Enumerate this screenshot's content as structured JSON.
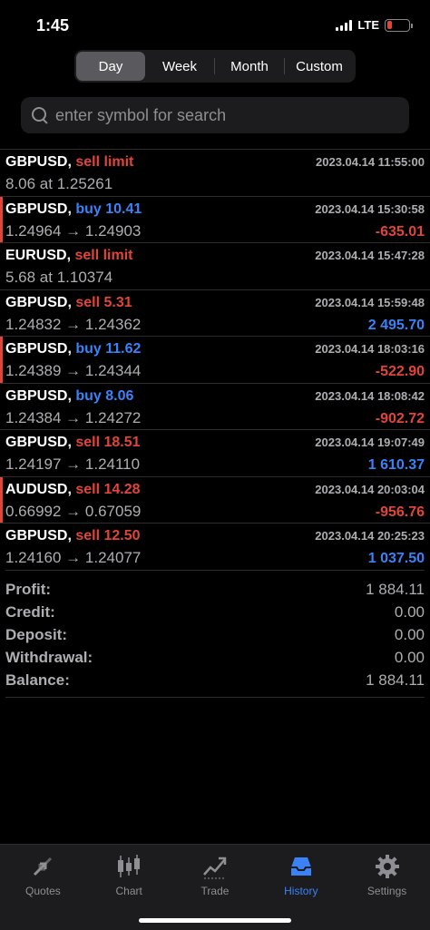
{
  "status": {
    "time": "1:45",
    "network": "LTE"
  },
  "periods": [
    "Day",
    "Week",
    "Month",
    "Custom"
  ],
  "search": {
    "placeholder": "enter symbol for search"
  },
  "deals": [
    {
      "symbol": "GBPUSD,",
      "type": "sell limit",
      "side": "sell",
      "date": "2023.04.14 11:55:00",
      "line2": "8.06 at 1.25261",
      "profit": "",
      "marked": false
    },
    {
      "symbol": "GBPUSD,",
      "type": "buy 10.41",
      "side": "buy",
      "date": "2023.04.14 15:30:58",
      "line2": "1.24964 → 1.24903",
      "profit": "-635.01",
      "marked": true
    },
    {
      "symbol": "EURUSD,",
      "type": "sell limit",
      "side": "sell",
      "date": "2023.04.14 15:47:28",
      "line2": "5.68 at 1.10374",
      "profit": "",
      "marked": false
    },
    {
      "symbol": "GBPUSD,",
      "type": "sell 5.31",
      "side": "sell",
      "date": "2023.04.14 15:59:48",
      "line2": "1.24832 → 1.24362",
      "profit": "2 495.70",
      "marked": false
    },
    {
      "symbol": "GBPUSD,",
      "type": "buy 11.62",
      "side": "buy",
      "date": "2023.04.14 18:03:16",
      "line2": "1.24389 → 1.24344",
      "profit": "-522.90",
      "marked": true
    },
    {
      "symbol": "GBPUSD,",
      "type": "buy 8.06",
      "side": "buy",
      "date": "2023.04.14 18:08:42",
      "line2": "1.24384 → 1.24272",
      "profit": "-902.72",
      "marked": false
    },
    {
      "symbol": "GBPUSD,",
      "type": "sell 18.51",
      "side": "sell",
      "date": "2023.04.14 19:07:49",
      "line2": "1.24197 → 1.24110",
      "profit": "1 610.37",
      "marked": false
    },
    {
      "symbol": "AUDUSD,",
      "type": "sell 14.28",
      "side": "sell",
      "date": "2023.04.14 20:03:04",
      "line2": "0.66992 → 0.67059",
      "profit": "-956.76",
      "marked": true
    },
    {
      "symbol": "GBPUSD,",
      "type": "sell 12.50",
      "side": "sell",
      "date": "2023.04.14 20:25:23",
      "line2": "1.24160 → 1.24077",
      "profit": "1 037.50",
      "marked": false
    }
  ],
  "summary": [
    {
      "label": "Profit:",
      "value": "1 884.11"
    },
    {
      "label": "Credit:",
      "value": "0.00"
    },
    {
      "label": "Deposit:",
      "value": "0.00"
    },
    {
      "label": "Withdrawal:",
      "value": "0.00"
    },
    {
      "label": "Balance:",
      "value": "1 884.11"
    }
  ],
  "tabs": [
    "Quotes",
    "Chart",
    "Trade",
    "History",
    "Settings"
  ],
  "colors": {
    "sell": "#e0453a",
    "buy": "#3b82f6",
    "accent": "#3b82f6"
  }
}
